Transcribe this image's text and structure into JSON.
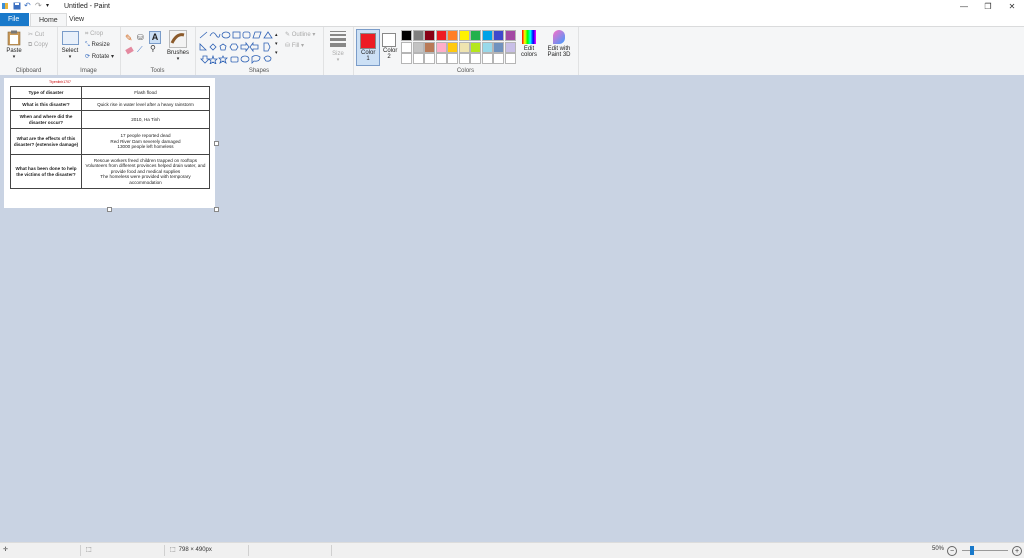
{
  "window": {
    "title": "Untitled - Paint",
    "minimize": "—",
    "restore": "❐",
    "close": "✕"
  },
  "tabs": {
    "file": "File",
    "home": "Home",
    "view": "View"
  },
  "clipboard": {
    "paste": "Paste",
    "cut": "Cut",
    "copy": "Copy",
    "label": "Clipboard"
  },
  "image": {
    "select": "Select",
    "crop": "Crop",
    "resize": "Resize",
    "rotate": "Rotate",
    "label": "Image"
  },
  "tools": {
    "label": "Tools",
    "brushes": "Brushes"
  },
  "shapes": {
    "outline": "Outline",
    "fill": "Fill",
    "label": "Shapes"
  },
  "size": {
    "label": "Size"
  },
  "colors": {
    "color1": "Color 1",
    "color2": "Color 2",
    "edit": "Edit colors",
    "paint3d": "Edit with Paint 3D",
    "label": "Colors",
    "color1_value": "#ed1c24",
    "color2_value": "#ffffff",
    "row1": [
      "#000000",
      "#7f7f7f",
      "#880015",
      "#ed1c24",
      "#ff7f27",
      "#fff200",
      "#22b14c",
      "#00a2e8",
      "#3f48cc",
      "#a349a4"
    ],
    "row2": [
      "#ffffff",
      "#c3c3c3",
      "#b97a57",
      "#ffaec9",
      "#ffc90e",
      "#efe4b0",
      "#b5e61d",
      "#99d9ea",
      "#7092be",
      "#c8bfe7"
    ],
    "row3": [
      "#ffffff",
      "#ffffff",
      "#ffffff",
      "#ffffff",
      "#ffffff",
      "#ffffff",
      "#ffffff",
      "#ffffff",
      "#ffffff",
      "#ffffff"
    ]
  },
  "document": {
    "signature": "Ttyenlinh1707",
    "rows": [
      {
        "q": "Type of disaster",
        "a": "Flash flood"
      },
      {
        "q": "What is this disaster?",
        "a": "Quick rise in water level after a heavy rainstorm"
      },
      {
        "q": "When and where did the disaster occur?",
        "a": "2010, Ha Tinh"
      },
      {
        "q": "What are the effects of this disaster? (extensive damage)",
        "a": "17 people reported dead\nRed River Dam severely damaged\n13000 people left homeless"
      },
      {
        "q": "What has been done to help the victims of the disaster?",
        "a": "Rescue workers freed children trapped on rooftops\nVolunteers from different provinces helped drain water, and provide food and medical supplies\nThe homeless were provided with temporary accommodation"
      }
    ]
  },
  "status": {
    "dimensions": "798 × 490px",
    "zoom": "50%"
  }
}
